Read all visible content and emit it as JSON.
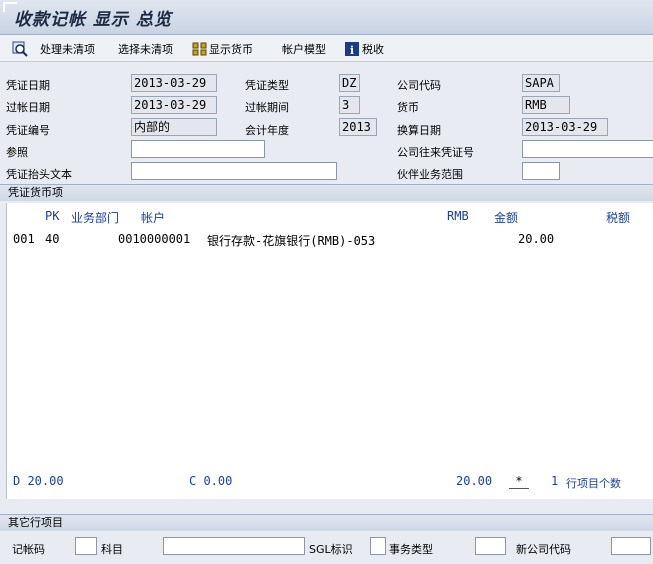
{
  "window": {
    "title": "收款记帐 显示 总览"
  },
  "toolbar": {
    "process_open": "处理未清项",
    "select_open": "选择未清项",
    "show_currency": "显示货币",
    "account_model": "帐户模型",
    "tax": "税收"
  },
  "header": {
    "doc_date_label": "凭证日期",
    "doc_date": "2013-03-29",
    "doc_type_label": "凭证类型",
    "doc_type": "DZ",
    "company_code_label": "公司代码",
    "company_code": "SAPA",
    "posting_date_label": "过帐日期",
    "posting_date": "2013-03-29",
    "period_label": "过帐期间",
    "period": "3",
    "currency_label": "货币",
    "currency": "RMB",
    "doc_number_label": "凭证编号",
    "doc_number": "内部的",
    "fiscal_year_label": "会计年度",
    "fiscal_year": "2013",
    "translation_date_label": "换算日期",
    "translation_date": "2013-03-29",
    "reference_label": "参照",
    "reference": "",
    "cross_company_label": "公司往来凭证号",
    "cross_company": "",
    "header_text_label": "凭证抬头文本",
    "header_text": "",
    "partner_area_label": "伙伴业务范围",
    "partner_area": ""
  },
  "items_panel": {
    "title": "凭证货币项",
    "columns": {
      "pk": "PK",
      "business_area": "业务部门",
      "account": "帐户",
      "currency": "RMB",
      "amount": "金额",
      "tax": "税额"
    },
    "rows": [
      {
        "line": "001",
        "pk": "40",
        "account": "0010000001",
        "desc": "银行存款-花旗银行(RMB)-053",
        "amount": "20.00"
      }
    ],
    "footer": {
      "debit": "D 20.00",
      "credit": "C 0.00",
      "balance": "20.00",
      "star": "*",
      "count": "1",
      "count_label": "行项目个数"
    }
  },
  "other_line": {
    "title": "其它行项目",
    "posting_key_label": "记帐码",
    "posting_key": "",
    "account_label": "科目",
    "account": "",
    "sgl_label": "SGL标识",
    "sgl": "",
    "trans_type_label": "事务类型",
    "trans_type": "",
    "new_company_label": "新公司代码",
    "new_company": ""
  }
}
